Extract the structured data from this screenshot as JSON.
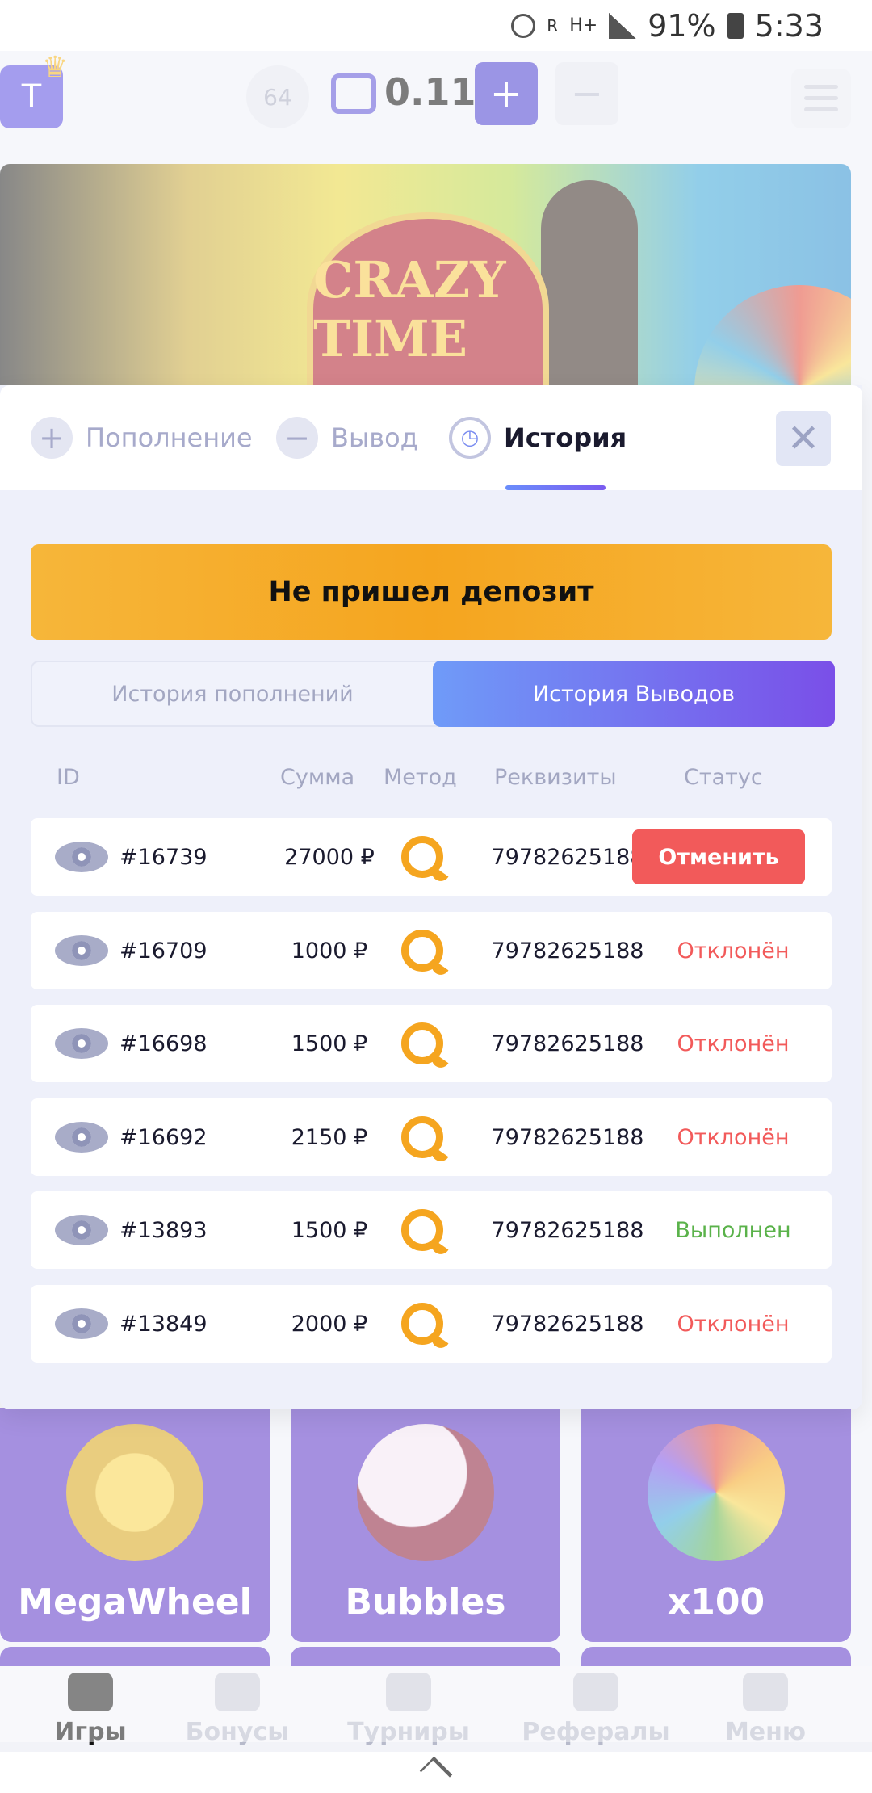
{
  "status_bar": {
    "battery": "91%",
    "time": "5:33",
    "network": "H+",
    "roaming": "R"
  },
  "header": {
    "avatar_letter": "T",
    "level": "64",
    "balance": "0.11",
    "deposit_symbol": "+",
    "withdraw_symbol": "−"
  },
  "banner": {
    "logo_text": "CRAZY TIME"
  },
  "game_tiles": [
    {
      "name": "MegaWheel"
    },
    {
      "name": "Bubbles"
    },
    {
      "name": "x100"
    }
  ],
  "bottom_nav": [
    {
      "label": "Игры",
      "active": true
    },
    {
      "label": "Бонусы"
    },
    {
      "label": "Турниры"
    },
    {
      "label": "Рефералы"
    },
    {
      "label": "Меню"
    }
  ],
  "modal": {
    "tabs": [
      {
        "label": "Пополнение",
        "icon": "plus-icon"
      },
      {
        "label": "Вывод",
        "icon": "minus-icon"
      },
      {
        "label": "История",
        "icon": "clock-icon",
        "active": true
      }
    ],
    "close_symbol": "✕",
    "no_deposit_button": "Не пришел депозит",
    "history_switch": {
      "deposits": "История пополнений",
      "withdrawals": "История Выводов",
      "active": "withdrawals"
    },
    "table": {
      "columns": [
        "ID",
        "Сумма",
        "Метод",
        "Реквизиты",
        "Статус"
      ],
      "rows": [
        {
          "id": "#16739",
          "amount": "27000 ₽",
          "method": "qiwi",
          "account": "79782625188",
          "status": "Отменить",
          "status_type": "cancel"
        },
        {
          "id": "#16709",
          "amount": "1000 ₽",
          "method": "qiwi",
          "account": "79782625188",
          "status": "Отклонён",
          "status_type": "declined"
        },
        {
          "id": "#16698",
          "amount": "1500 ₽",
          "method": "qiwi",
          "account": "79782625188",
          "status": "Отклонён",
          "status_type": "declined"
        },
        {
          "id": "#16692",
          "amount": "2150 ₽",
          "method": "qiwi",
          "account": "79782625188",
          "status": "Отклонён",
          "status_type": "declined"
        },
        {
          "id": "#13893",
          "amount": "1500 ₽",
          "method": "qiwi",
          "account": "79782625188",
          "status": "Выполнен",
          "status_type": "done"
        },
        {
          "id": "#13849",
          "amount": "2000 ₽",
          "method": "qiwi",
          "account": "79782625188",
          "status": "Отклонён",
          "status_type": "declined"
        }
      ]
    }
  },
  "colors": {
    "accent": "#5a4de0",
    "warning": "#f5a51f",
    "danger": "#f25a5a",
    "success": "#5ab24a"
  }
}
